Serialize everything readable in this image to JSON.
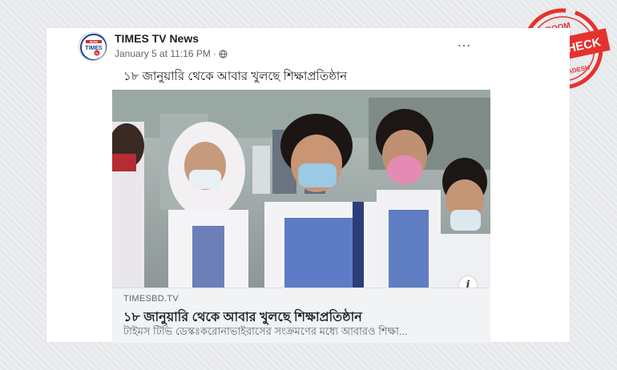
{
  "post": {
    "page_name": "TIMES TV News",
    "date": "January 5 at 11:16 PM",
    "separator": "·",
    "more_icon": "…",
    "caption": "১৮ জানুয়ারি থেকে আবার খুলছে শিক্ষাপ্রতিষ্ঠান"
  },
  "avatar": {
    "logo_top": "NEWS",
    "logo_main": "TIMES",
    "logo_sub": "tv"
  },
  "link": {
    "domain": "TIMESBD.TV",
    "title": "১৮ জানুয়ারি থেকে আবার খুলছে শিক্ষাপ্রতিষ্ঠান",
    "description": "টাইমস টিভি ডেস্কঃকরোনাভাইরাসের সংক্রমণের মধ্যে আবারও শিক্ষা...",
    "info_icon": "i"
  },
  "stamp": {
    "top": "BOOM",
    "main": "FACT CHECK",
    "bottom": "BANGLADESH",
    "color": "#e5322d"
  }
}
